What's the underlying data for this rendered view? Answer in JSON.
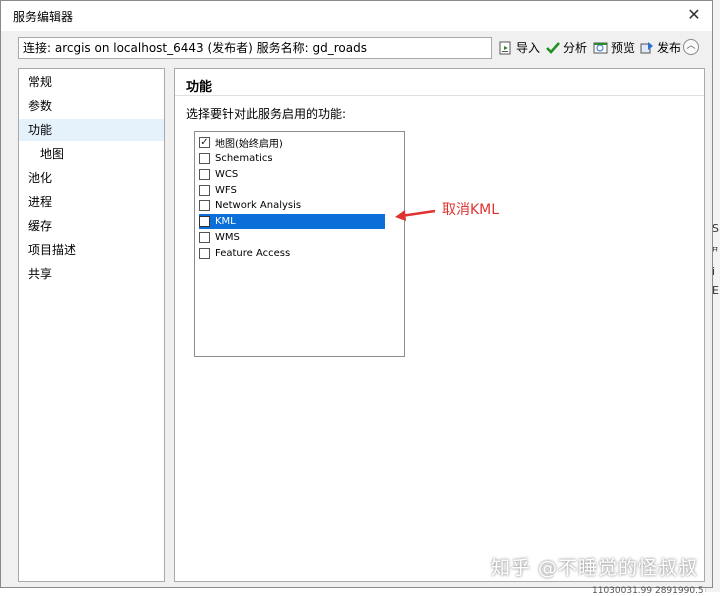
{
  "window": {
    "title": "服务编辑器",
    "close": "✕"
  },
  "toolbar": {
    "connection": "连接: arcgis on localhost_6443 (发布者)   服务名称: gd_roads",
    "import_label": "导入",
    "analyze_label": "分析",
    "preview_label": "预览",
    "publish_label": "发布",
    "collapse": "︿"
  },
  "nav": {
    "items": [
      {
        "label": "常规"
      },
      {
        "label": "参数"
      },
      {
        "label": "功能"
      },
      {
        "label": "地图"
      },
      {
        "label": "池化"
      },
      {
        "label": "进程"
      },
      {
        "label": "缓存"
      },
      {
        "label": "项目描述"
      },
      {
        "label": "共享"
      }
    ]
  },
  "panel": {
    "title": "功能",
    "description": "选择要针对此服务启用的功能:",
    "capabilities": [
      {
        "label": "地图(始终启用)",
        "checked": true
      },
      {
        "label": "Schematics",
        "checked": false
      },
      {
        "label": "WCS",
        "checked": false
      },
      {
        "label": "WFS",
        "checked": false
      },
      {
        "label": "Network Analysis",
        "checked": false
      },
      {
        "label": "KML",
        "checked": false
      },
      {
        "label": "WMS",
        "checked": false
      },
      {
        "label": "Feature Access",
        "checked": false
      }
    ]
  },
  "annotation": {
    "text": "取消KML",
    "color": "#e0332f"
  },
  "watermark": "知乎 @不睡觉的怪叔叔",
  "background_fragments": [
    "S",
    "ꟸ",
    "i",
    "E",
    "11030031.99  2891990.5"
  ],
  "colors": {
    "selection": "#0a6fd8",
    "nav_selected": "#e5f1fb"
  }
}
